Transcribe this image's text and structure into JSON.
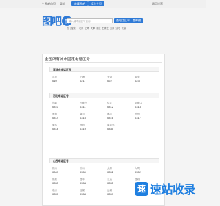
{
  "topbar": {
    "home_label": "图吧首页",
    "sep_label": "导航",
    "btn1_label": "收藏图吧",
    "btn2_label": "设为主页",
    "fav_label": "网页设置"
  },
  "logo": {
    "text": "图吧",
    "badge_line1": "电话",
    "badge_line2": "区号"
  },
  "search": {
    "placeholder": "输入城市或区号查询",
    "btn1_label": "查电话区号",
    "btn2_label": "查邮编"
  },
  "hotlinks": [
    "热门搜索：",
    "北京",
    "上海",
    "天津",
    "重庆",
    "石家庄",
    "太原",
    "沈阳",
    "长春"
  ],
  "main": {
    "title": "全国所有城市固定电话区号"
  },
  "sections": [
    {
      "title": "直辖市电话区号",
      "cells": [
        {
          "city": "北京",
          "code": "010"
        },
        {
          "city": "上海",
          "code": "021"
        },
        {
          "city": "天津",
          "code": "022"
        },
        {
          "city": "重庆",
          "code": "023"
        }
      ]
    },
    {
      "title": "河北电话区号",
      "cells": [
        {
          "city": "邯郸",
          "code": "0310"
        },
        {
          "city": "石家庄",
          "code": "0311"
        },
        {
          "city": "保定",
          "code": "0312"
        },
        {
          "city": "张家口",
          "code": "0313"
        },
        {
          "city": "承德",
          "code": "0314"
        },
        {
          "city": "唐山",
          "code": "0315"
        },
        {
          "city": "廊坊",
          "code": "0316"
        },
        {
          "city": "沧州",
          "code": "0317"
        },
        {
          "city": "衡水",
          "code": "0318"
        },
        {
          "city": "邢台",
          "code": "0319"
        },
        {
          "city": "秦皇岛",
          "code": "0335"
        }
      ]
    },
    {
      "title": "山西电话区号",
      "cells": [
        {
          "city": "朔州",
          "code": "0349"
        },
        {
          "city": "忻州",
          "code": "0350"
        },
        {
          "city": "太原",
          "code": "0351"
        },
        {
          "city": "大同",
          "code": "0352"
        },
        {
          "city": "阳泉",
          "code": "0353"
        },
        {
          "city": "晋中",
          "code": "0354"
        },
        {
          "city": "长治",
          "code": "0355"
        },
        {
          "city": "晋城",
          "code": "0356"
        },
        {
          "city": "临汾",
          "code": "0357"
        },
        {
          "city": "吕梁",
          "code": "0358"
        },
        {
          "city": "运城",
          "code": "0359"
        }
      ]
    }
  ],
  "watermark": {
    "icon": "速",
    "text": "速站收录"
  }
}
